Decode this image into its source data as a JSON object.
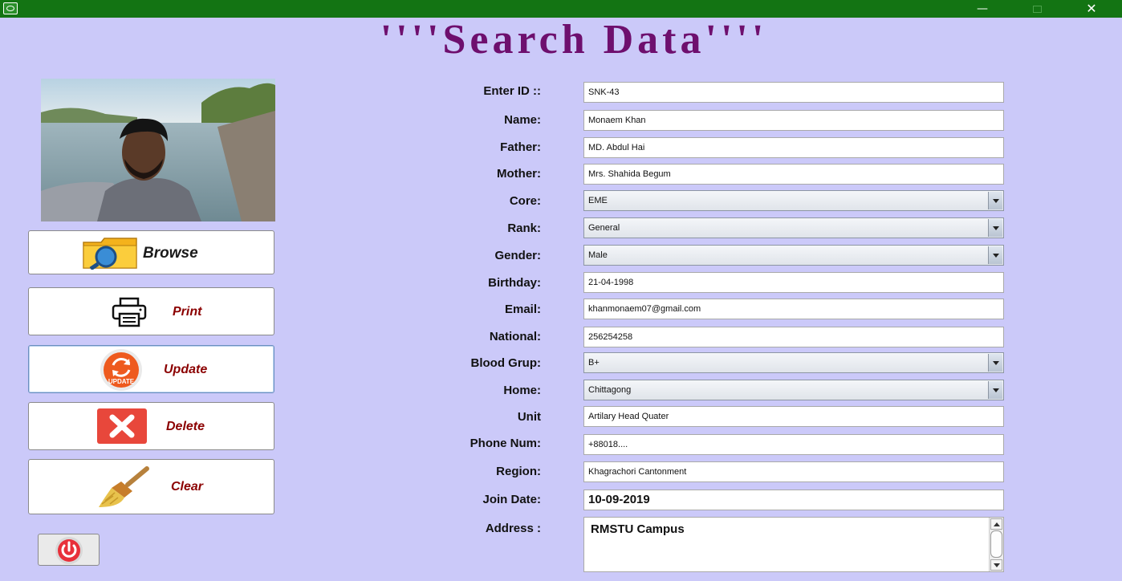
{
  "window": {
    "app_icon": "app-icon",
    "controls": {
      "minimize": "—",
      "close": "✕"
    }
  },
  "page": {
    "title": "''''Search Data''''"
  },
  "photo": {
    "icon": "user-photo"
  },
  "buttons": {
    "browse": {
      "label": "Browse",
      "icon": "folder-search-icon"
    },
    "print": {
      "label": "Print",
      "icon": "printer-icon"
    },
    "update": {
      "label": "Update",
      "icon": "update-icon",
      "icon_text": "UPDATE"
    },
    "delete": {
      "label": "Delete",
      "icon": "delete-x-icon"
    },
    "clear": {
      "label": "Clear",
      "icon": "broom-icon"
    },
    "power": {
      "icon": "power-icon"
    }
  },
  "form": {
    "id": {
      "label": "Enter ID ::",
      "value": "SNK-43"
    },
    "name": {
      "label": "Name:",
      "value": "Monaem Khan"
    },
    "father": {
      "label": "Father:",
      "value": "MD. Abdul Hai"
    },
    "mother": {
      "label": "Mother:",
      "value": "Mrs. Shahida Begum"
    },
    "core": {
      "label": "Core:",
      "value": "EME"
    },
    "rank": {
      "label": "Rank:",
      "value": "General"
    },
    "gender": {
      "label": "Gender:",
      "value": "Male"
    },
    "birthday": {
      "label": "Birthday:",
      "value": "21-04-1998"
    },
    "email": {
      "label": "Email:",
      "value": "khanmonaem07@gmail.com"
    },
    "national": {
      "label": "National:",
      "value": "256254258"
    },
    "blood": {
      "label": "Blood Grup:",
      "value": "B+"
    },
    "home": {
      "label": "Home:",
      "value": "Chittagong"
    },
    "unit": {
      "label": "Unit",
      "value": "Artilary Head Quater"
    },
    "phone": {
      "label": "Phone Num:",
      "value": "+88018...."
    },
    "region": {
      "label": "Region:",
      "value": "Khagrachori Cantonment"
    },
    "join_date": {
      "label": "Join Date:",
      "value": "10-09-2019"
    },
    "address": {
      "label": "Address :",
      "value": "RMSTU Campus"
    }
  },
  "colors": {
    "background": "#cbc9f9",
    "titlebar": "#137413",
    "title_text": "#6e0f6e",
    "button_label": "#8b0000"
  }
}
